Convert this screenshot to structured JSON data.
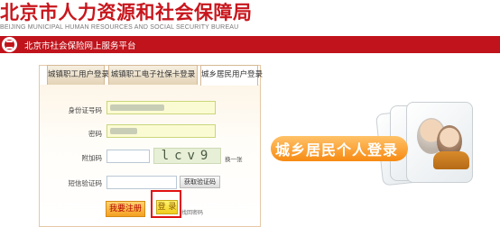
{
  "header": {
    "title": "北京市人力资源和社会保障局",
    "subtitle": "BEIJING MUNICIPAL HUMAN RESOURCES AND SOCIAL SECURITY BUREAU"
  },
  "nav": {
    "site_name": "北京市社会保险网上服务平台"
  },
  "tabs": [
    {
      "label": "城镇职工用户登录"
    },
    {
      "label": "城镇职工电子社保卡登录"
    },
    {
      "label": "城乡居民用户登录"
    }
  ],
  "form": {
    "id_label": "身份证号码",
    "password_label": "密码",
    "captcha_label": "附加码",
    "captcha_value": "lcv9",
    "refresh_label": "换一张",
    "sms_label": "短信验证码",
    "get_sms_button": "获取验证码",
    "register_button": "我要注册",
    "login_button": "登 录",
    "forgot_link": "找回密码"
  },
  "promo": {
    "text": "城乡居民个人登录"
  },
  "colors": {
    "brand_red": "#c0131b",
    "accent_orange": "#f78a12"
  }
}
